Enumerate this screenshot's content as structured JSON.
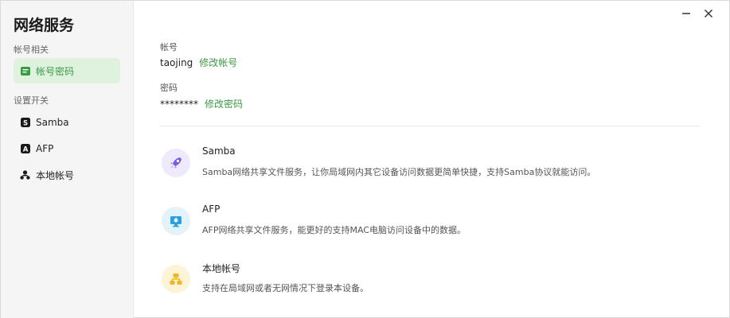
{
  "app": {
    "title": "网络服务"
  },
  "sidebar": {
    "section_account": "帐号相关",
    "section_settings": "设置开关",
    "items": [
      {
        "label": "帐号密码",
        "icon": "card-icon",
        "active": true
      },
      {
        "label": "Samba",
        "icon": "samba-icon",
        "active": false
      },
      {
        "label": "AFP",
        "icon": "afp-icon",
        "active": false
      },
      {
        "label": "本地帐号",
        "icon": "user-group-icon",
        "active": false
      }
    ]
  },
  "window_controls": {
    "minimize": "minimize-icon",
    "close": "close-icon"
  },
  "account": {
    "username_label": "帐号",
    "username_value": "taojing",
    "username_link": "修改帐号",
    "password_label": "密码",
    "password_value": "********",
    "password_link": "修改密码"
  },
  "services": [
    {
      "name": "Samba",
      "desc": "Samba网络共享文件服务，让你局域网内其它设备访问数据更简单快捷，支持Samba协议就能访问。",
      "icon": "rocket-icon",
      "color": "#7b5ce0"
    },
    {
      "name": "AFP",
      "desc": "AFP网络共享文件服务，能更好的支持MAC电脑访问设备中的数据。",
      "icon": "monitor-icon",
      "color": "#2aa0e0"
    },
    {
      "name": "本地帐号",
      "desc": "支持在局域网或者无网情况下登录本设备。",
      "icon": "network-icon",
      "color": "#f0b820"
    }
  ],
  "colors": {
    "accent": "#3a9b43",
    "active_bg": "#dff2de"
  }
}
